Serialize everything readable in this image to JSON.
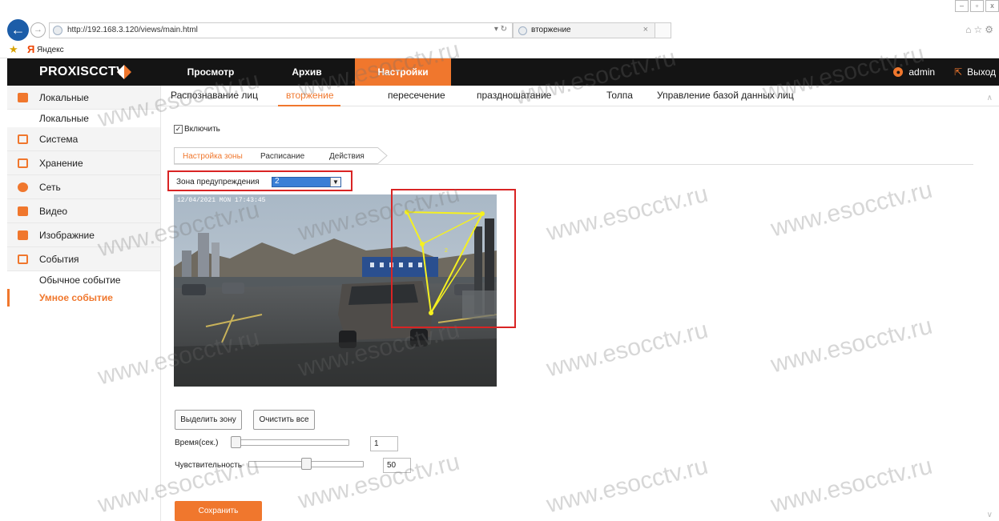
{
  "browser": {
    "url": "http://192.168.3.120/views/main.html",
    "tab_title": "вторжение",
    "favorites": "Яндекс"
  },
  "header": {
    "logo": "PROXISCCTV",
    "nav": [
      {
        "label": "Просмотр"
      },
      {
        "label": "Архив"
      },
      {
        "label": "Настройки",
        "active": true
      }
    ],
    "user": "admin",
    "logout": "Выход"
  },
  "sidebar": {
    "items": [
      {
        "label": "Локальные",
        "sub": [
          "Локальные"
        ]
      },
      {
        "label": "Система"
      },
      {
        "label": "Хранение"
      },
      {
        "label": "Сеть"
      },
      {
        "label": "Видео"
      },
      {
        "label": "Изображние"
      },
      {
        "label": "События",
        "sub": [
          "Обычное событие",
          "Умное событие"
        ]
      }
    ],
    "active_sub": "Умное событие"
  },
  "sub_tabs": [
    {
      "label": "Распознавание лиц"
    },
    {
      "label": "вторжение",
      "active": true
    },
    {
      "label": "пересечение"
    },
    {
      "label": "праздношатание"
    },
    {
      "label": "Толпа"
    },
    {
      "label": "Управление базой данных лиц"
    }
  ],
  "enable": {
    "label": "Включить",
    "checked": true
  },
  "steps": [
    "Настройка зоны",
    "Расписание",
    "Действия"
  ],
  "zone": {
    "label": "Зона предупреждения",
    "value": "2"
  },
  "video": {
    "timestamp": "12/04/2021  MON  17:43:45"
  },
  "buttons": {
    "select_zone": "Выделить зону",
    "clear_all": "Очистить все",
    "save": "Сохранить"
  },
  "params": {
    "time": {
      "label": "Время(сек.)",
      "value": "1",
      "level": 0.0
    },
    "sensitivity": {
      "label": "Чувствительность",
      "value": "50",
      "level": 0.5
    }
  },
  "watermark": "www.esocctv.ru",
  "colors": {
    "accent": "#f0772d",
    "header_bg": "#141414",
    "highlight_red": "#d92424",
    "zone_line": "#f5f020"
  }
}
